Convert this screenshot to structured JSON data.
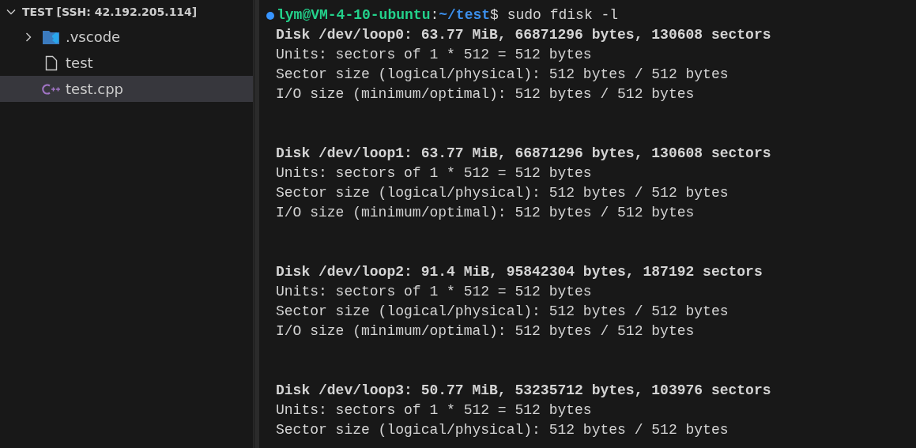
{
  "explorer": {
    "title": "TEST [SSH: 42.192.205.114]",
    "expanded": true,
    "items": [
      {
        "kind": "folder",
        "label": ".vscode",
        "expanded": false,
        "selected": false
      },
      {
        "kind": "file",
        "label": "test",
        "selected": false
      },
      {
        "kind": "cpp",
        "label": "test.cpp",
        "selected": true
      }
    ]
  },
  "terminal": {
    "prompt": {
      "user_host": "lym@VM-4-10-ubuntu",
      "separator": ":",
      "path": "~/test",
      "command": "$ sudo fdisk -l"
    },
    "disks": [
      {
        "header": "Disk /dev/loop0: 63.77 MiB, 66871296 bytes, 130608 sectors",
        "lines": [
          "Units: sectors of 1 * 512 = 512 bytes",
          "Sector size (logical/physical): 512 bytes / 512 bytes",
          "I/O size (minimum/optimal): 512 bytes / 512 bytes"
        ]
      },
      {
        "header": "Disk /dev/loop1: 63.77 MiB, 66871296 bytes, 130608 sectors",
        "lines": [
          "Units: sectors of 1 * 512 = 512 bytes",
          "Sector size (logical/physical): 512 bytes / 512 bytes",
          "I/O size (minimum/optimal): 512 bytes / 512 bytes"
        ]
      },
      {
        "header": "Disk /dev/loop2: 91.4 MiB, 95842304 bytes, 187192 sectors",
        "lines": [
          "Units: sectors of 1 * 512 = 512 bytes",
          "Sector size (logical/physical): 512 bytes / 512 bytes",
          "I/O size (minimum/optimal): 512 bytes / 512 bytes"
        ]
      },
      {
        "header": "Disk /dev/loop3: 50.77 MiB, 53235712 bytes, 103976 sectors",
        "lines": [
          "Units: sectors of 1 * 512 = 512 bytes",
          "Sector size (logical/physical): 512 bytes / 512 bytes"
        ]
      }
    ]
  }
}
